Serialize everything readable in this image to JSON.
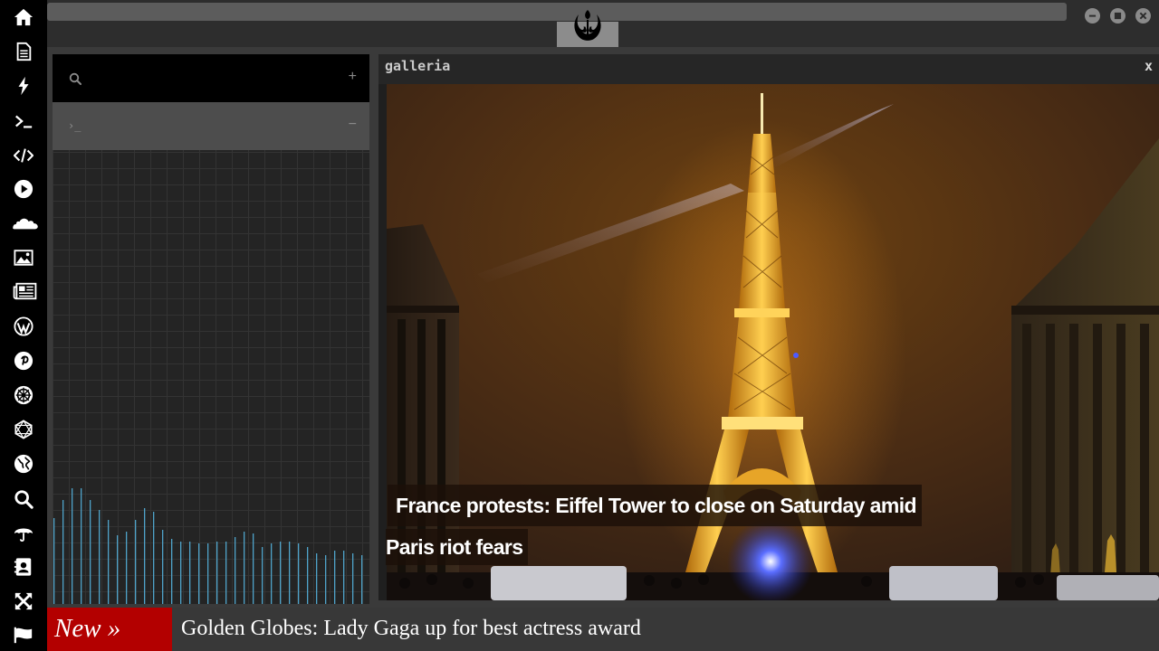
{
  "sidebar": {
    "items": [
      {
        "icon": "home-icon",
        "label": "home"
      },
      {
        "icon": "document-icon",
        "label": "documents"
      },
      {
        "icon": "lightning-icon",
        "label": "power"
      },
      {
        "icon": "terminal-icon",
        "label": "terminal"
      },
      {
        "icon": "code-icon",
        "label": "code"
      },
      {
        "icon": "play-icon",
        "label": "media player"
      },
      {
        "icon": "cloud-icon",
        "label": "cloud"
      },
      {
        "icon": "image-icon",
        "label": "galleria"
      },
      {
        "icon": "newspaper-icon",
        "label": "news"
      },
      {
        "icon": "wordpress-icon",
        "label": "wordpress"
      },
      {
        "icon": "pinterest-icon",
        "label": "pinterest"
      },
      {
        "icon": "galactic-empire-icon",
        "label": "empire"
      },
      {
        "icon": "network-icon",
        "label": "network"
      },
      {
        "icon": "globe-icon",
        "label": "globe"
      },
      {
        "icon": "search-icon",
        "label": "search"
      },
      {
        "icon": "umbrella-icon",
        "label": "weather"
      },
      {
        "icon": "contact-card-icon",
        "label": "contacts"
      },
      {
        "icon": "expand-icon",
        "label": "fullscreen"
      },
      {
        "icon": "flag-icon",
        "label": "flag"
      }
    ]
  },
  "topbar": {
    "address_value": "",
    "logo_icon": "rebel-alliance-icon",
    "window_controls": [
      "minimize-icon",
      "maximize-icon",
      "close-icon"
    ]
  },
  "left_panel": {
    "search_placeholder": "",
    "add_label": "+",
    "terminal_prompt": "›_",
    "collapse_label": "−",
    "visualizer_levels": [
      0.44,
      0.53,
      0.59,
      0.59,
      0.53,
      0.48,
      0.43,
      0.35,
      0.37,
      0.43,
      0.49,
      0.47,
      0.38,
      0.33,
      0.32,
      0.32,
      0.31,
      0.31,
      0.32,
      0.32,
      0.34,
      0.37,
      0.36,
      0.29,
      0.31,
      0.32,
      0.32,
      0.31,
      0.29,
      0.26,
      0.25,
      0.27,
      0.27,
      0.26,
      0.25
    ]
  },
  "gallery": {
    "title": "galleria",
    "close_label": "x",
    "caption_line1": "France protests: Eiffel Tower to close on Saturday amid",
    "caption_line2": "Paris riot fears"
  },
  "ticker": {
    "badge": "New »",
    "headline": "Golden Globes: Lady Gaga up for best actress award"
  },
  "colors": {
    "accent": "#b30000",
    "visualizer": "#4fa3c9",
    "sidebar_bg": "#000000"
  }
}
